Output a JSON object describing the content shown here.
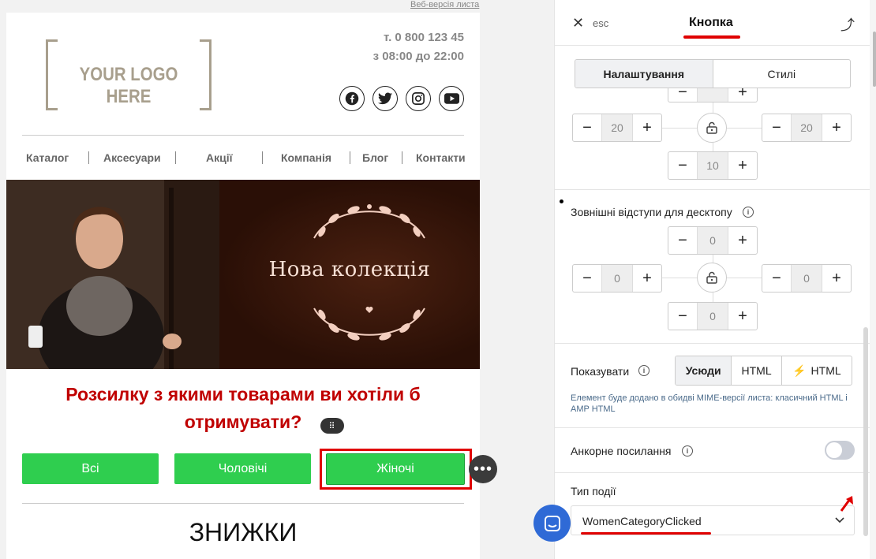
{
  "email": {
    "web_version_link": "Веб-версія листа",
    "logo_text": "YOUR LOGO HERE",
    "phone": "т. 0 800 123 45",
    "hours": "з 08:00 до 22:00",
    "social_icons": [
      "facebook-icon",
      "twitter-icon",
      "instagram-icon",
      "youtube-icon"
    ],
    "nav": [
      "Каталог",
      "Аксесуари",
      "Акції",
      "Компанія",
      "Блог",
      "Контакти"
    ],
    "hero_title": "Нова колекція",
    "question": "Розсилку з якими товарами ви хотіли б отримувати?",
    "category_buttons": [
      "Всі",
      "Чоловічі",
      "Жіночі"
    ],
    "section_title": "ЗНИЖКИ",
    "button_color": "#2fce4f",
    "question_color": "#c00000"
  },
  "panel": {
    "close_label": "esc",
    "title": "Кнопка",
    "tabs": [
      "Налаштування",
      "Стилі"
    ],
    "padding": {
      "left": "20",
      "right": "20",
      "bottom": "10"
    },
    "margins_label": "Зовнішні відступи для десктопу",
    "margins": {
      "top": "0",
      "left": "0",
      "right": "0",
      "bottom": "0"
    },
    "show_label": "Показувати",
    "show_options": [
      "Усюди",
      "HTML",
      "HTML"
    ],
    "show_note": "Елемент буде додано в обидві MIME-версії листа: класичний HTML і AMP HTML",
    "anchor_label": "Анкорне посилання",
    "anchor_enabled": false,
    "event_type_label": "Тип події",
    "event_type_value": "WomenCategoryClicked",
    "highlight_color": "#e00000"
  }
}
